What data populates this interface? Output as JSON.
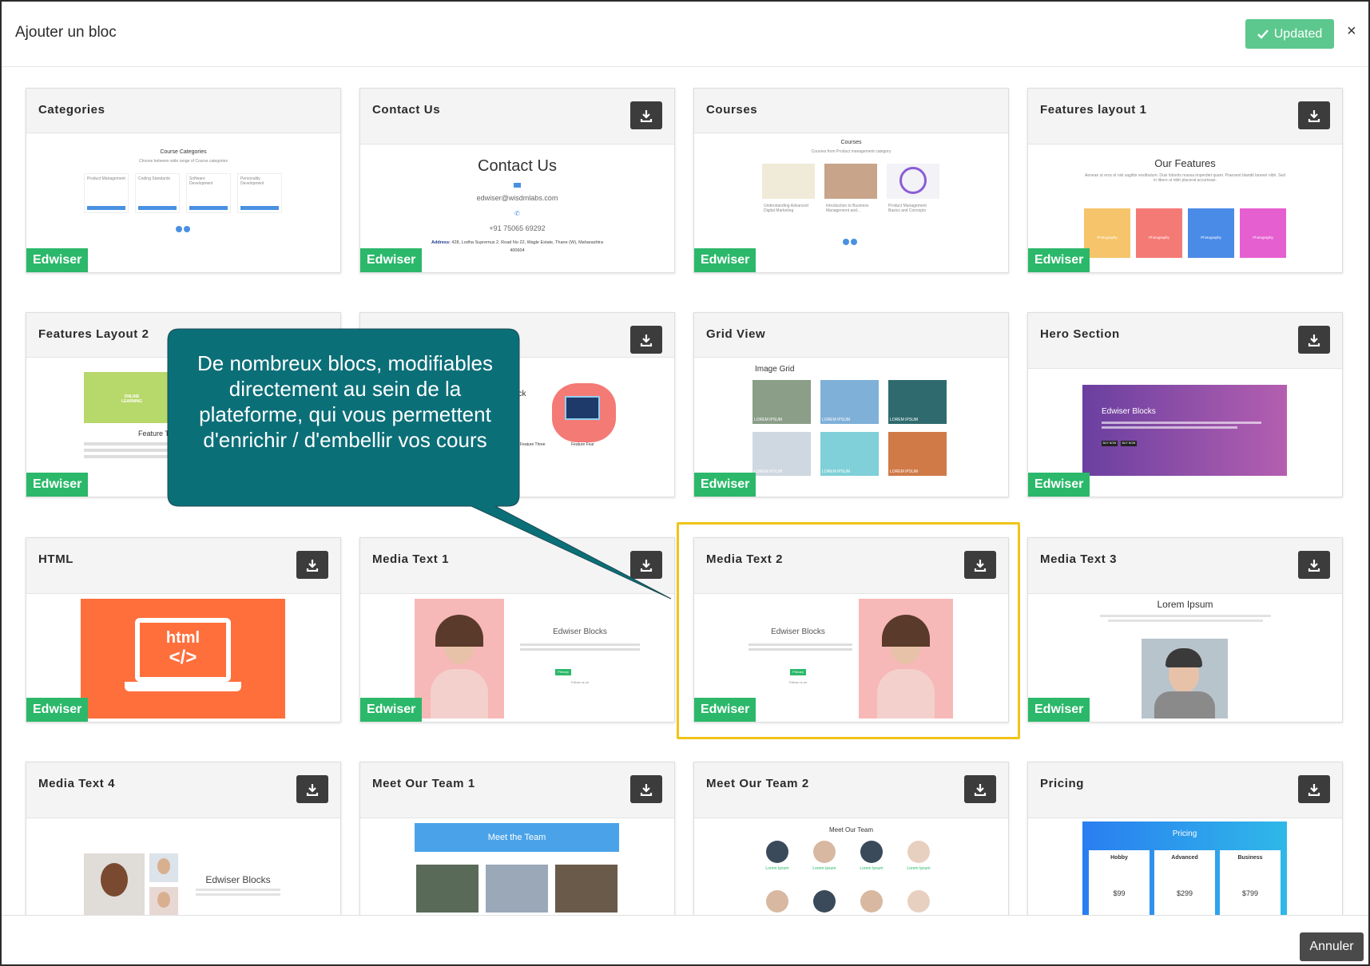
{
  "modal": {
    "title": "Ajouter un bloc",
    "updated_label": "Updated",
    "close_label": "×",
    "cancel_label": "Annuler"
  },
  "badge_label": "Edwiser",
  "colors": {
    "accent_green": "#2bb86a",
    "updated_green": "#5cc88d",
    "callout_teal": "#0b6f78",
    "highlight_yellow": "#f0c419"
  },
  "callout": {
    "text": "De nombreux blocs, modifiables directement au sein de la plateforme, qui vous permettent d'enrichir / d'embellir vos cours"
  },
  "cards": [
    {
      "title": "Categories",
      "preview": {
        "heading": "Course Categories",
        "sub": "Choose between wide range of Course categories",
        "items": [
          "Product Management",
          "Coding Standards",
          "Software Development",
          "Personality Development"
        ]
      }
    },
    {
      "title": "Contact Us",
      "preview": {
        "heading": "Contact Us",
        "email": "edwiser@wisdmlabs.com",
        "phone": "+91 75065 69292",
        "address_label": "Address:",
        "address": "428, Lodha Supremus 2, Road No 22, Wagle Estate, Thane (W), Maharashtra",
        "zip": "400604"
      }
    },
    {
      "title": "Courses",
      "preview": {
        "heading": "Courses",
        "sub": "Courses from Product management category",
        "items": [
          "Understanding Advanced Digital Marketing",
          "Introduction to Business Management and...",
          "Product Management Basics and Concepts"
        ]
      }
    },
    {
      "title": "Features layout 1",
      "preview": {
        "heading": "Our Features",
        "sub": "Aenean ut eros et nisl sagittis vestibulum. Duis lobortis massa imperdiet quam. Praesent blandit laoreet nibh. Sed in libero ut nibh placerat accumsan.",
        "tiles": [
          "Photography",
          "Photography",
          "Photography",
          "Photography"
        ]
      }
    },
    {
      "title": "Features Layout 2",
      "preview": {
        "heading": "Feature Two",
        "image_text": "ONLINE LEARNING"
      }
    },
    {
      "title": "",
      "preview": {
        "heading": "ock",
        "items": [
          "Feature Three",
          "Feature Four"
        ]
      }
    },
    {
      "title": "Grid View",
      "preview": {
        "heading": "Image Grid",
        "tile_label": "LOREM IPSUM"
      }
    },
    {
      "title": "Hero Section",
      "preview": {
        "heading": "Edwiser Blocks",
        "buttons": [
          "BUY NOW",
          "BUY NOW"
        ]
      }
    },
    {
      "title": "HTML",
      "preview": {
        "code_label": "html",
        "code_symbol": "</>"
      }
    },
    {
      "title": "Media Text 1",
      "preview": {
        "heading": "Edwiser Blocks",
        "button": "Primary",
        "follow": "Follow us on"
      }
    },
    {
      "title": "Media Text 2",
      "preview": {
        "heading": "Edwiser Blocks",
        "button": "Primary",
        "follow": "Follow us on"
      }
    },
    {
      "title": "Media Text 3",
      "preview": {
        "heading": "Lorem Ipsum"
      }
    },
    {
      "title": "Media Text 4",
      "preview": {
        "heading": "Edwiser Blocks"
      }
    },
    {
      "title": "Meet Our Team 1",
      "preview": {
        "heading": "Meet the Team"
      }
    },
    {
      "title": "Meet Our Team 2",
      "preview": {
        "heading": "Meet Our Team",
        "member": "Lorem Ipsum"
      }
    },
    {
      "title": "Pricing",
      "preview": {
        "heading": "Pricing",
        "plans": [
          {
            "name": "Hobby",
            "price": "$99"
          },
          {
            "name": "Advanced",
            "price": "$299"
          },
          {
            "name": "Business",
            "price": "$799"
          }
        ]
      }
    }
  ]
}
